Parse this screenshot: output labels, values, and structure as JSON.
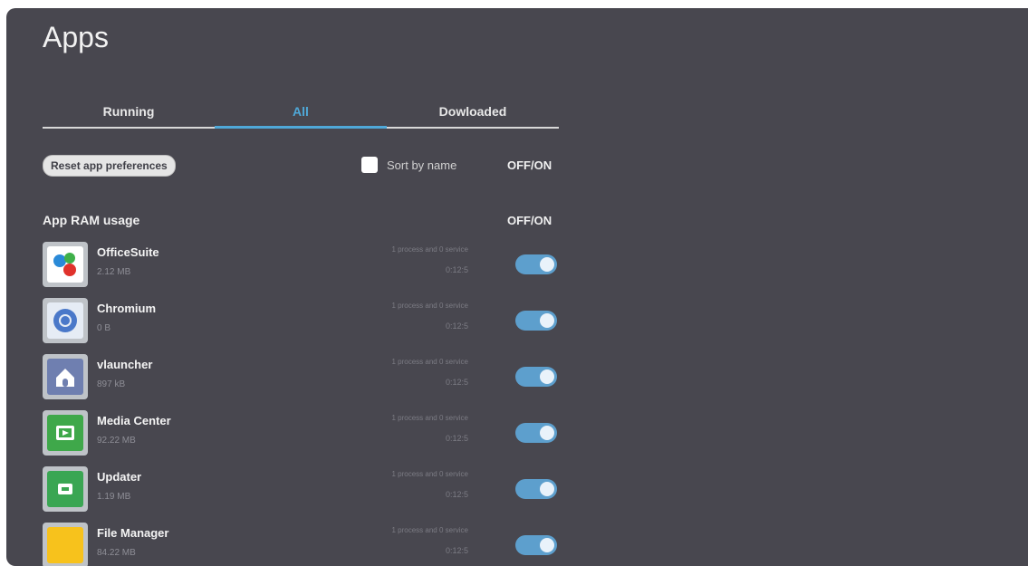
{
  "page": {
    "title": "Apps"
  },
  "tabs": [
    {
      "label": "Running"
    },
    {
      "label": "All"
    },
    {
      "label": "Dowloaded"
    }
  ],
  "controls": {
    "reset_label": "Reset app preferences",
    "sort_label": "Sort by name",
    "sort_offon": "OFF/ON",
    "ram_label": "App RAM usage",
    "ram_offon": "OFF/ON"
  },
  "apps": [
    {
      "name": "OfficeSuite",
      "size": "2.12 MB",
      "process": "1 process and 0 service",
      "time": "0:12:5",
      "icon": "officesuite-icon",
      "color": "#ffffff"
    },
    {
      "name": "Chromium",
      "size": "0 B",
      "process": "1 process and 0 service",
      "time": "0:12:5",
      "icon": "chromium-icon",
      "color": "#e6ecf5"
    },
    {
      "name": "vlauncher",
      "size": "897 kB",
      "process": "1 process and 0 service",
      "time": "0:12:5",
      "icon": "home-icon",
      "color": "#6f7fb0"
    },
    {
      "name": "Media Center",
      "size": "92.22 MB",
      "process": "1 process and 0 service",
      "time": "0:12:5",
      "icon": "media-center-icon",
      "color": "#3fa84a"
    },
    {
      "name": "Updater",
      "size": "1.19 MB",
      "process": "1 process and 0 service",
      "time": "0:12:5",
      "icon": "updater-icon",
      "color": "#3aa653"
    },
    {
      "name": "File Manager",
      "size": "84.22 MB",
      "process": "1 process and 0 service",
      "time": "0:12:5",
      "icon": "folder-icon",
      "color": "#f7c21c"
    }
  ],
  "colors": {
    "panel": "#48474f",
    "accent": "#4fa8d8",
    "toggle_on": "#5d9fcd"
  }
}
